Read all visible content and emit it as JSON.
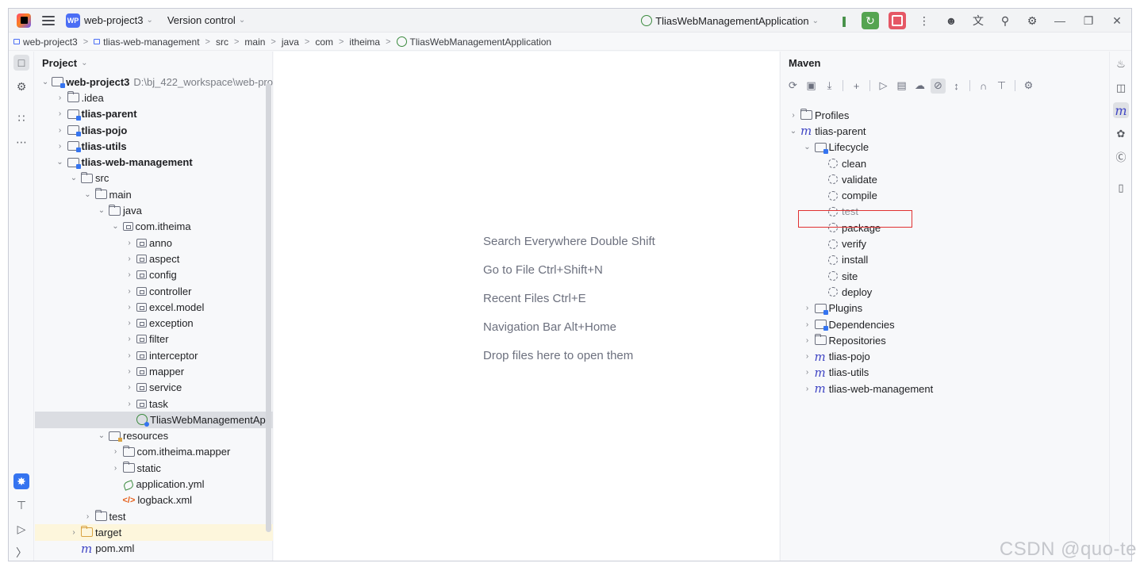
{
  "titlebar": {
    "project_badge": "WP",
    "project_name": "web-project3",
    "vcs_label": "Version control",
    "run_config": "TliasWebManagementApplication"
  },
  "breadcrumb": [
    {
      "label": "web-project3",
      "icon": "module-icon"
    },
    {
      "label": "tlias-web-management",
      "icon": "module-icon"
    },
    {
      "label": "src"
    },
    {
      "label": "main"
    },
    {
      "label": "java"
    },
    {
      "label": "com"
    },
    {
      "label": "itheima"
    },
    {
      "label": "TliasWebManagementApplication",
      "icon": "spring-class-icon"
    }
  ],
  "project_panel": {
    "title": "Project",
    "tree": [
      {
        "indent": 0,
        "arrow": "v",
        "icon": "module",
        "label": "web-project3",
        "bold": true,
        "path": "D:\\bj_422_workspace\\web-pro"
      },
      {
        "indent": 1,
        "arrow": ">",
        "icon": "folder",
        "label": ".idea"
      },
      {
        "indent": 1,
        "arrow": ">",
        "icon": "module",
        "label": "tlias-parent",
        "bold": true
      },
      {
        "indent": 1,
        "arrow": ">",
        "icon": "module",
        "label": "tlias-pojo",
        "bold": true
      },
      {
        "indent": 1,
        "arrow": ">",
        "icon": "module",
        "label": "tlias-utils",
        "bold": true
      },
      {
        "indent": 1,
        "arrow": "v",
        "icon": "module",
        "label": "tlias-web-management",
        "bold": true
      },
      {
        "indent": 2,
        "arrow": "v",
        "icon": "folder",
        "label": "src"
      },
      {
        "indent": 3,
        "arrow": "v",
        "icon": "folder",
        "label": "main"
      },
      {
        "indent": 4,
        "arrow": "v",
        "icon": "folder",
        "label": "java"
      },
      {
        "indent": 5,
        "arrow": "v",
        "icon": "pkg",
        "label": "com.itheima"
      },
      {
        "indent": 6,
        "arrow": ">",
        "icon": "pkg",
        "label": "anno"
      },
      {
        "indent": 6,
        "arrow": ">",
        "icon": "pkg",
        "label": "aspect"
      },
      {
        "indent": 6,
        "arrow": ">",
        "icon": "pkg",
        "label": "config"
      },
      {
        "indent": 6,
        "arrow": ">",
        "icon": "pkg",
        "label": "controller"
      },
      {
        "indent": 6,
        "arrow": ">",
        "icon": "pkg",
        "label": "excel.model"
      },
      {
        "indent": 6,
        "arrow": ">",
        "icon": "pkg",
        "label": "exception"
      },
      {
        "indent": 6,
        "arrow": ">",
        "icon": "pkg",
        "label": "filter"
      },
      {
        "indent": 6,
        "arrow": ">",
        "icon": "pkg",
        "label": "interceptor"
      },
      {
        "indent": 6,
        "arrow": ">",
        "icon": "pkg",
        "label": "mapper"
      },
      {
        "indent": 6,
        "arrow": ">",
        "icon": "pkg",
        "label": "service"
      },
      {
        "indent": 6,
        "arrow": ">",
        "icon": "pkg",
        "label": "task"
      },
      {
        "indent": 6,
        "arrow": "",
        "icon": "cls",
        "label": "TliasWebManagementApp",
        "selected": true
      },
      {
        "indent": 4,
        "arrow": "v",
        "icon": "res",
        "label": "resources"
      },
      {
        "indent": 5,
        "arrow": ">",
        "icon": "folder",
        "label": "com.itheima.mapper"
      },
      {
        "indent": 5,
        "arrow": ">",
        "icon": "folder",
        "label": "static"
      },
      {
        "indent": 5,
        "arrow": "",
        "icon": "yml",
        "label": "application.yml"
      },
      {
        "indent": 5,
        "arrow": "",
        "icon": "xml",
        "label": "logback.xml"
      },
      {
        "indent": 3,
        "arrow": ">",
        "icon": "folder",
        "label": "test"
      },
      {
        "indent": 2,
        "arrow": ">",
        "icon": "folder-orange",
        "label": "target",
        "highlight": true
      },
      {
        "indent": 2,
        "arrow": "",
        "icon": "mvn",
        "label": "pom.xml"
      }
    ]
  },
  "editor_hints": [
    "Search Everywhere Double Shift",
    "Go to File Ctrl+Shift+N",
    "Recent Files Ctrl+E",
    "Navigation Bar Alt+Home",
    "Drop files here to open them"
  ],
  "maven_panel": {
    "title": "Maven",
    "tree": [
      {
        "indent": 0,
        "arrow": ">",
        "icon": "folder",
        "label": "Profiles"
      },
      {
        "indent": 0,
        "arrow": "v",
        "icon": "mvn",
        "label": "tlias-parent"
      },
      {
        "indent": 1,
        "arrow": "v",
        "icon": "module",
        "label": "Lifecycle"
      },
      {
        "indent": 2,
        "arrow": "",
        "icon": "gear",
        "label": "clean"
      },
      {
        "indent": 2,
        "arrow": "",
        "icon": "gear",
        "label": "validate"
      },
      {
        "indent": 2,
        "arrow": "",
        "icon": "gear",
        "label": "compile"
      },
      {
        "indent": 2,
        "arrow": "",
        "icon": "gear",
        "label": "test",
        "dim": true
      },
      {
        "indent": 2,
        "arrow": "",
        "icon": "gear",
        "label": "package",
        "boxed": true
      },
      {
        "indent": 2,
        "arrow": "",
        "icon": "gear",
        "label": "verify"
      },
      {
        "indent": 2,
        "arrow": "",
        "icon": "gear",
        "label": "install"
      },
      {
        "indent": 2,
        "arrow": "",
        "icon": "gear",
        "label": "site"
      },
      {
        "indent": 2,
        "arrow": "",
        "icon": "gear",
        "label": "deploy"
      },
      {
        "indent": 1,
        "arrow": ">",
        "icon": "module",
        "label": "Plugins"
      },
      {
        "indent": 1,
        "arrow": ">",
        "icon": "module",
        "label": "Dependencies"
      },
      {
        "indent": 1,
        "arrow": ">",
        "icon": "folder",
        "label": "Repositories"
      },
      {
        "indent": 1,
        "arrow": ">",
        "icon": "mvn",
        "label": "tlias-pojo"
      },
      {
        "indent": 1,
        "arrow": ">",
        "icon": "mvn",
        "label": "tlias-utils"
      },
      {
        "indent": 1,
        "arrow": ">",
        "icon": "mvn",
        "label": "tlias-web-management"
      }
    ]
  },
  "watermark": "CSDN @quo-te",
  "colors": {
    "accent": "#3574f0",
    "highlight_box": "#e03131",
    "run_green": "#55a451",
    "stop_red": "#e55765"
  }
}
